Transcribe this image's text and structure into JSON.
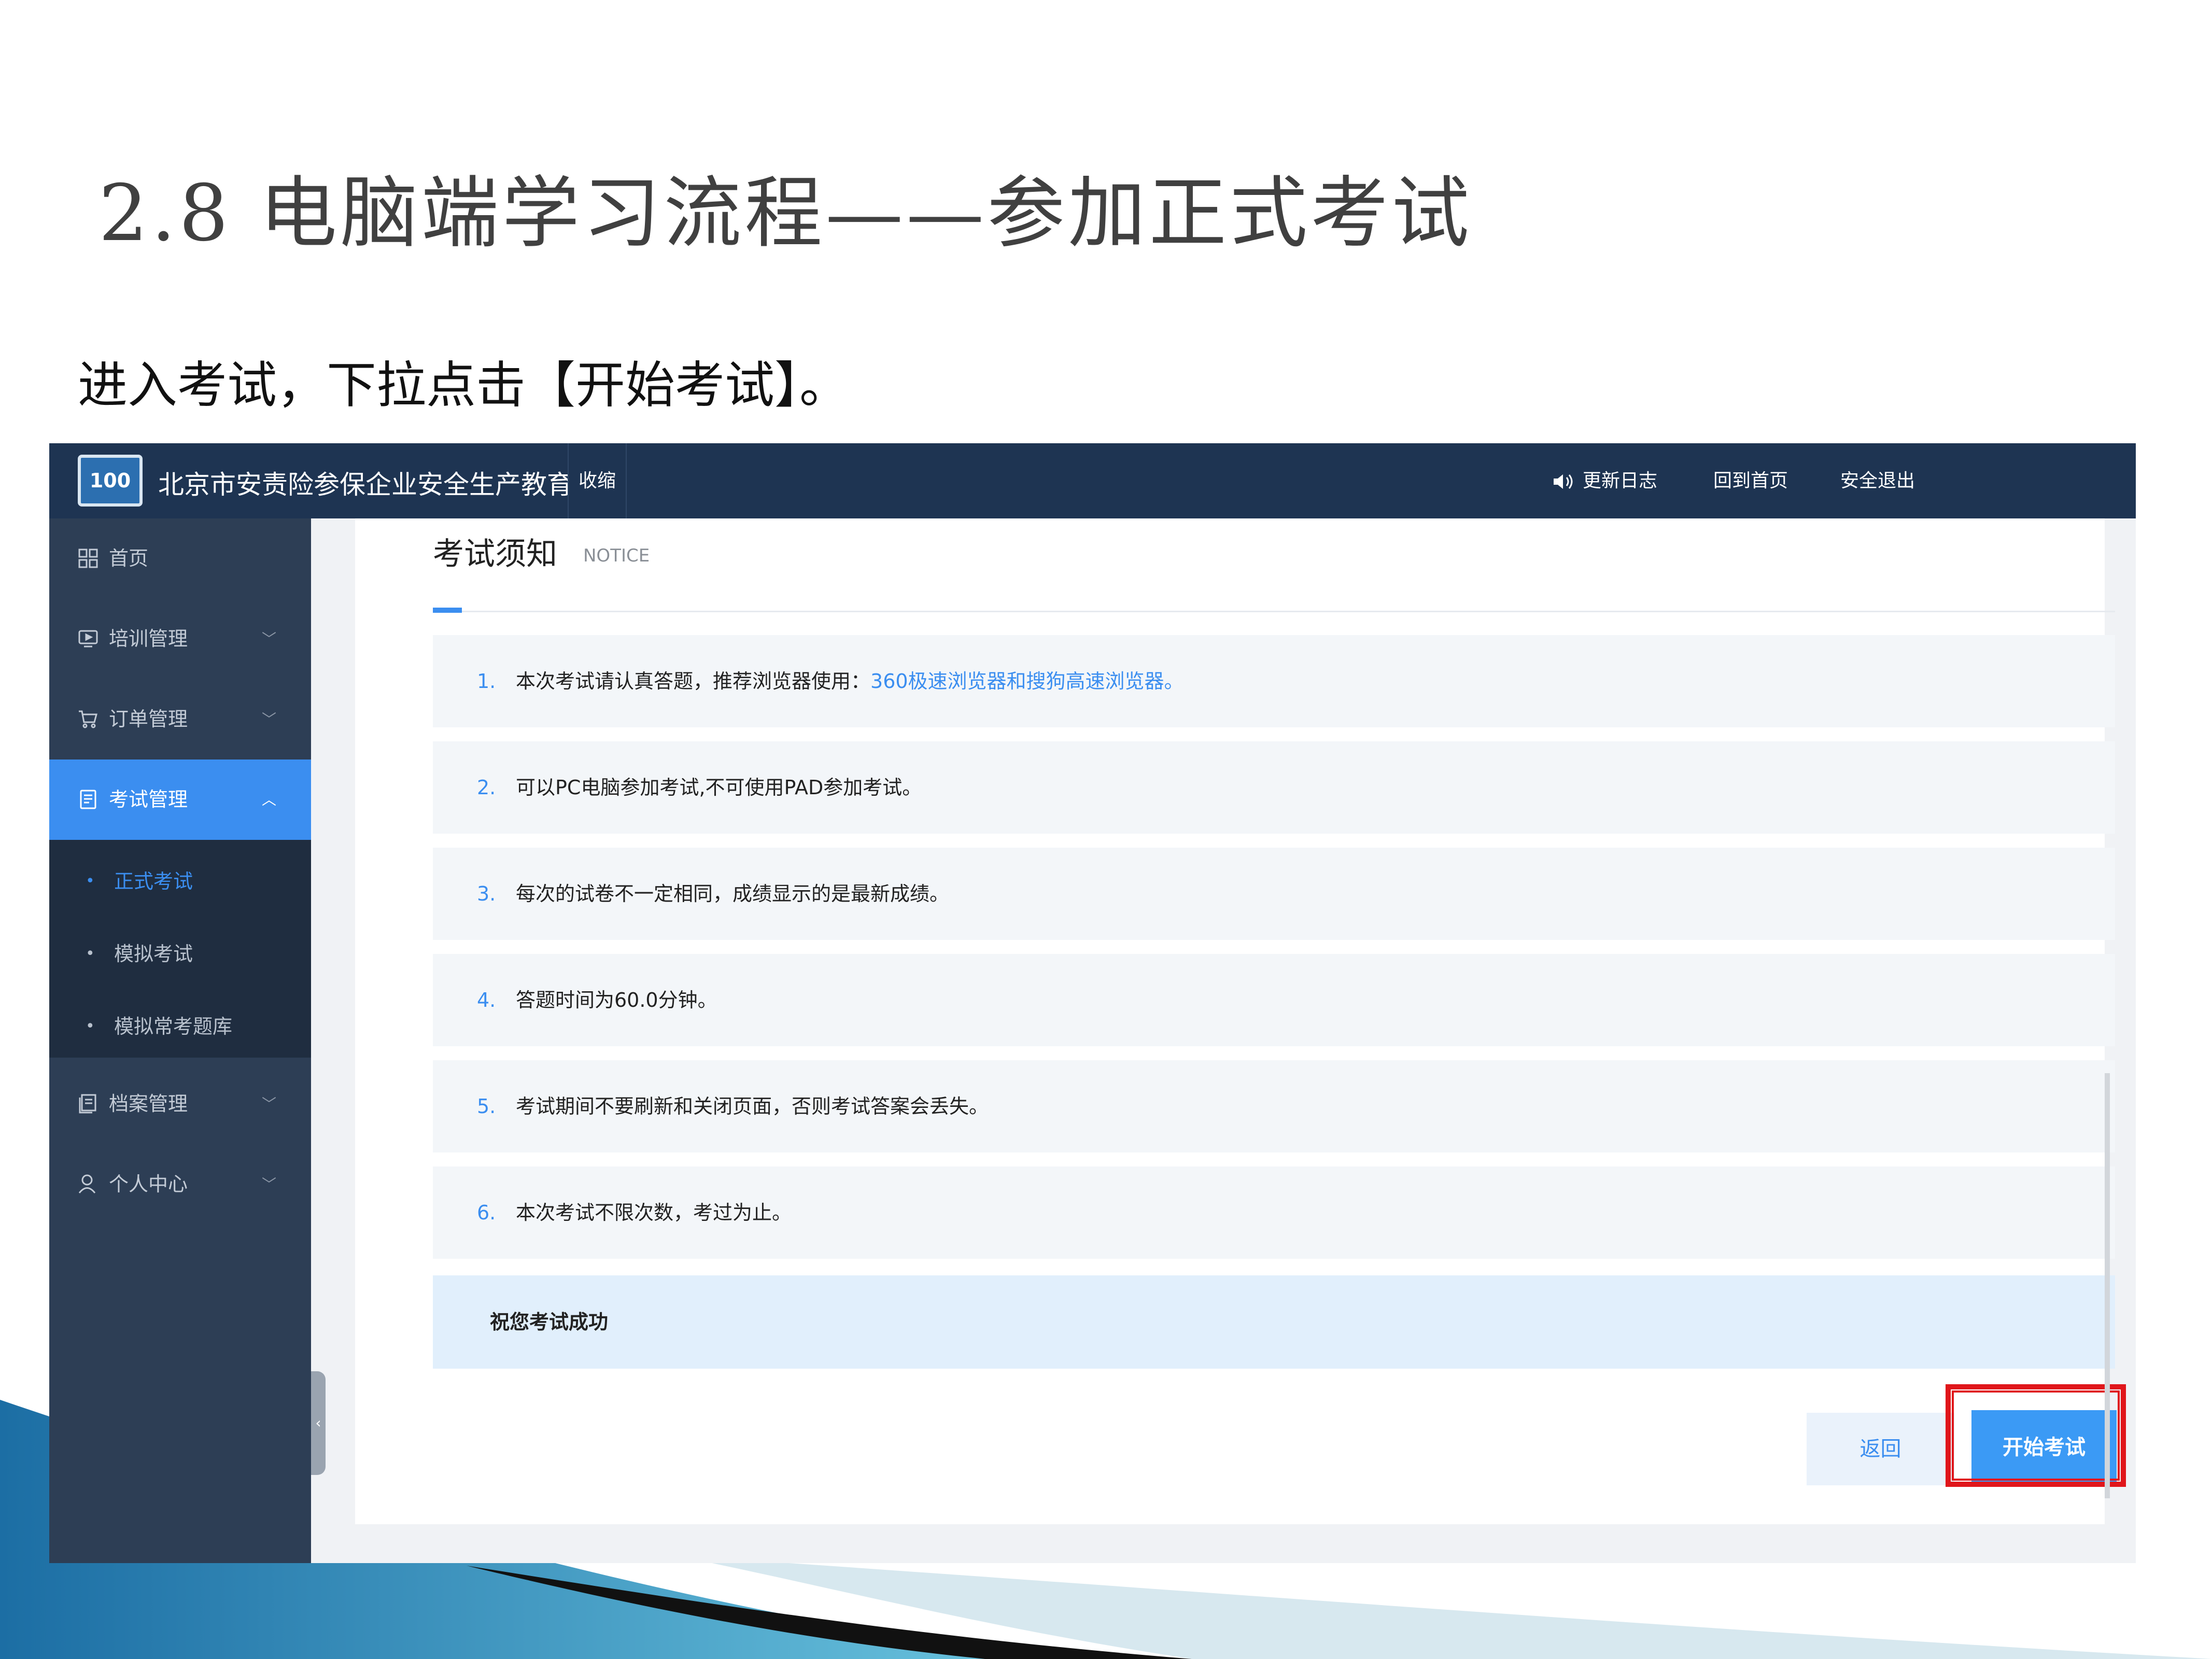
{
  "slide": {
    "title": "2.8 电脑端学习流程——参加正式考试",
    "subtitle": "进入考试，下拉点击【开始考试】。"
  },
  "header": {
    "logo_text": "100",
    "org_name": "北京市安责险参保企业安全生产教育",
    "collapse": "收缩",
    "update_log": "更新日志",
    "home": "回到首页",
    "logout": "安全退出"
  },
  "sidebar": {
    "items": [
      {
        "label": "首页",
        "icon": "grid-icon"
      },
      {
        "label": "培训管理",
        "icon": "monitor-icon"
      },
      {
        "label": "订单管理",
        "icon": "cart-icon"
      },
      {
        "label": "考试管理",
        "icon": "document-icon"
      },
      {
        "label": "档案管理",
        "icon": "archive-icon"
      },
      {
        "label": "个人中心",
        "icon": "user-icon"
      }
    ],
    "sub_items": [
      "正式考试",
      "模拟考试",
      "模拟常考题库"
    ]
  },
  "notice": {
    "title": "考试须知",
    "title_en": "NOTICE",
    "rules": [
      {
        "num": "1.",
        "text": "本次考试请认真答题，推荐浏览器使用：",
        "highlight": "360极速浏览器和搜狗高速浏览器。"
      },
      {
        "num": "2.",
        "text": "可以PC电脑参加考试,不可使用PAD参加考试。"
      },
      {
        "num": "3.",
        "text": "每次的试卷不一定相同，成绩显示的是最新成绩。"
      },
      {
        "num": "4.",
        "text": "答题时间为60.0分钟。"
      },
      {
        "num": "5.",
        "text": "考试期间不要刷新和关闭页面，否则考试答案会丢失。"
      },
      {
        "num": "6.",
        "text": "本次考试不限次数，考过为止。"
      }
    ],
    "wish": "祝您考试成功"
  },
  "actions": {
    "back": "返回",
    "start": "开始考试"
  },
  "colors": {
    "topbar": "#1e3452",
    "sidebar": "#2d3e55",
    "accent": "#3b8ef0",
    "highlight_box": "#e0161b"
  }
}
